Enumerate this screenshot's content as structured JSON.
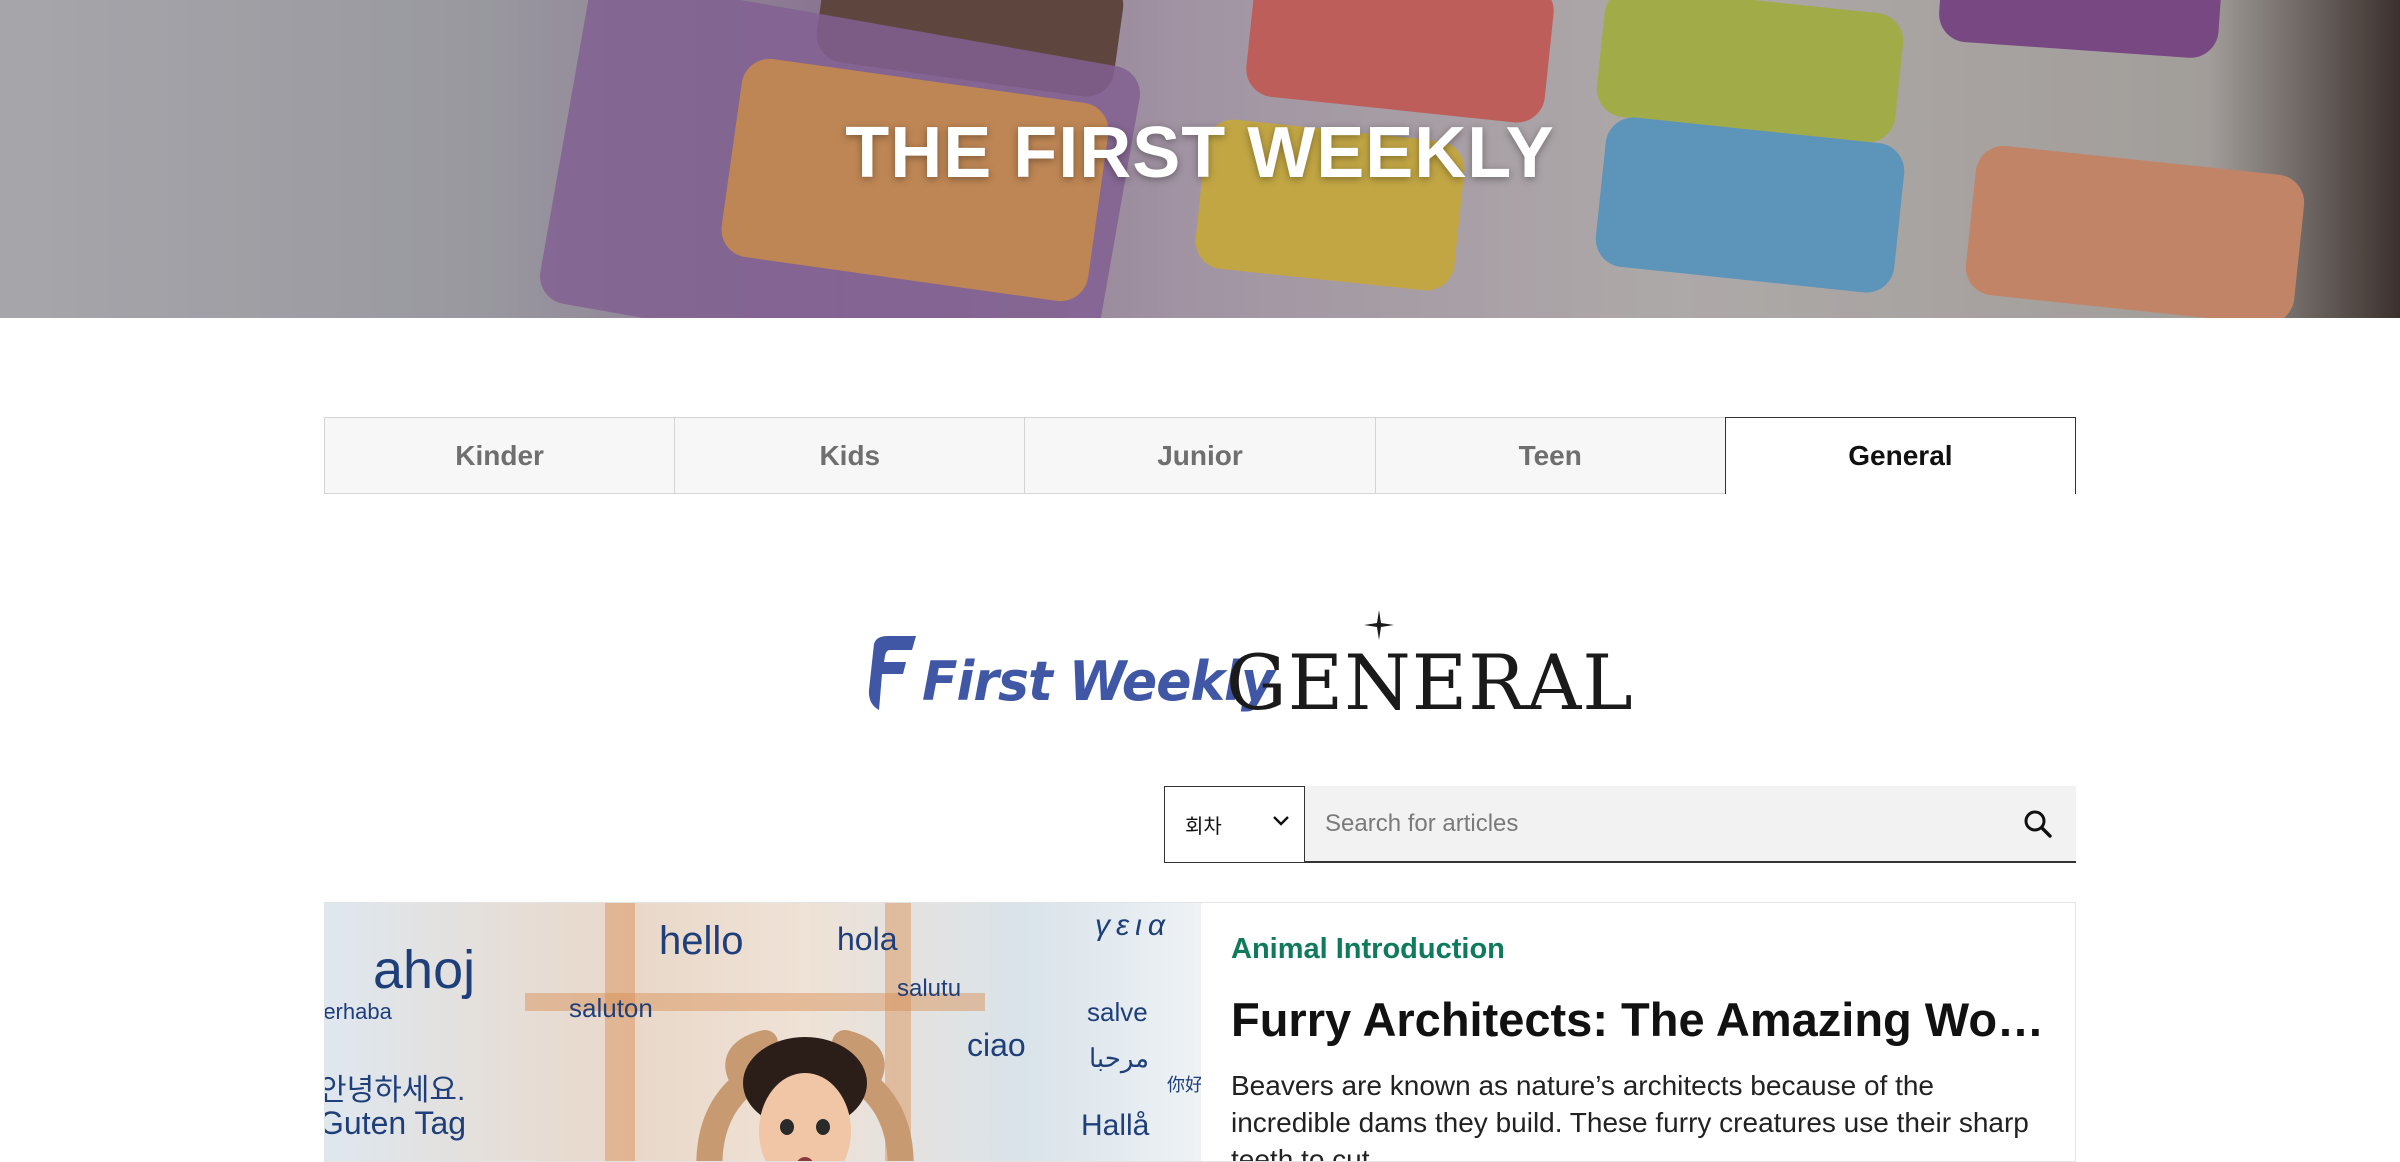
{
  "hero": {
    "title": "THE FIRST WEEKLY"
  },
  "tabs": [
    {
      "label": "Kinder",
      "active": false
    },
    {
      "label": "Kids",
      "active": false
    },
    {
      "label": "Junior",
      "active": false
    },
    {
      "label": "Teen",
      "active": false
    },
    {
      "label": "General",
      "active": true
    }
  ],
  "brand": {
    "wordmark": "First Weekly",
    "edition": "GENERAL",
    "color": "#3f57a5"
  },
  "search": {
    "select_value": "회차",
    "placeholder": "Search for articles",
    "icon": "search-icon"
  },
  "article": {
    "category": "Animal Introduction",
    "title": "Furry Architects: The Amazing World of Beavers",
    "excerpt": "Beavers are known as nature’s architects because of the incredible dams they build. These furry creatures use their sharp teeth to cut",
    "category_color": "#0f7a5c",
    "image_words": [
      "ahoj",
      "hello",
      "hola",
      "salutu",
      "saluton",
      "ciao",
      "salve",
      "Hallå",
      "γεια",
      "مرحبا",
      "你好",
      "안녕하세요.",
      "Guten Tag",
      "merhaba"
    ]
  }
}
